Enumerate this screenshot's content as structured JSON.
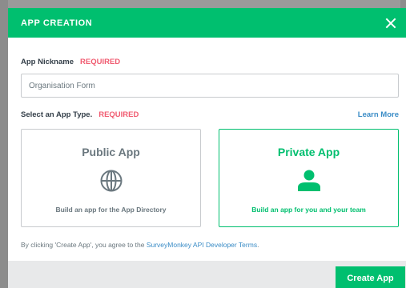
{
  "modal": {
    "title": "APP CREATION",
    "close_icon": "close-icon"
  },
  "nickname": {
    "label": "App Nickname",
    "required": "REQUIRED",
    "value": "Organisation Form",
    "placeholder": ""
  },
  "app_type": {
    "label": "Select an App Type.",
    "required": "REQUIRED",
    "learn_more": "Learn More",
    "selected": "private",
    "cards": [
      {
        "id": "public",
        "title": "Public App",
        "icon": "globe-icon",
        "description": "Build an app for the App Directory"
      },
      {
        "id": "private",
        "title": "Private App",
        "icon": "user-icon",
        "description": "Build an app for you and your team"
      }
    ]
  },
  "terms": {
    "prefix": "By clicking 'Create App', you agree to the ",
    "link": "SurveyMonkey API Developer Terms",
    "suffix": "."
  },
  "footer": {
    "create_button": "Create App"
  },
  "colors": {
    "brand_green": "#00bf6f",
    "required_red": "#f05b70",
    "link_blue": "#3a8cc6",
    "text_gray": "#6b787f"
  }
}
